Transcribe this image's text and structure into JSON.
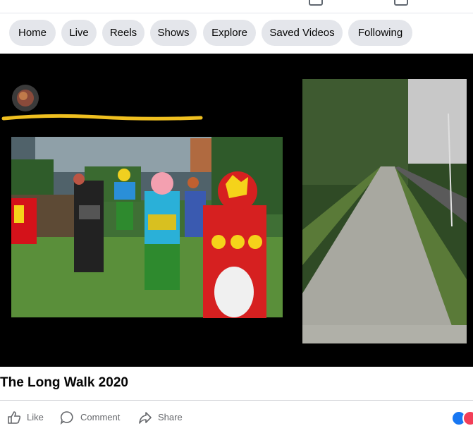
{
  "nav": {
    "tabs": [
      {
        "label": "Home"
      },
      {
        "label": "Live"
      },
      {
        "label": "Reels"
      },
      {
        "label": "Shows"
      },
      {
        "label": "Explore"
      },
      {
        "label": "Saved Videos"
      },
      {
        "label": "Following"
      }
    ]
  },
  "video": {
    "title": "The Long Walk 2020"
  },
  "actions": {
    "like_label": "Like",
    "comment_label": "Comment",
    "share_label": "Share"
  },
  "colors": {
    "pill_bg": "#e4e6eb",
    "text_primary": "#050505",
    "text_secondary": "#65676b",
    "like_blue": "#1877f2",
    "love_red": "#f33e58"
  },
  "icons": [
    "like-icon",
    "comment-icon",
    "share-icon",
    "like-reaction-icon",
    "love-reaction-icon"
  ]
}
